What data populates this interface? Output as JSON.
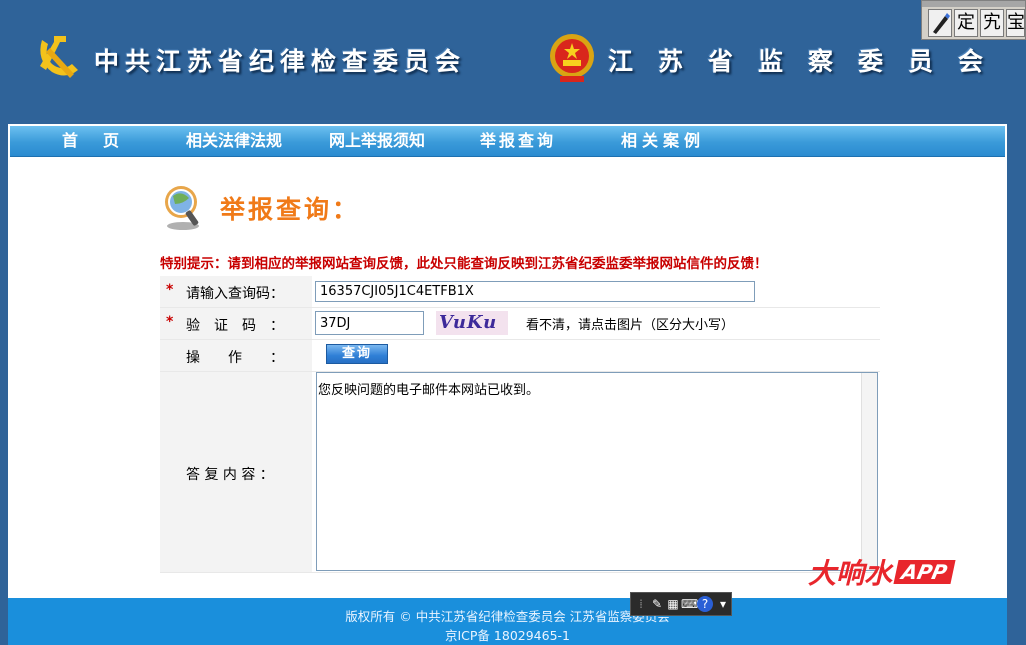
{
  "header": {
    "title_left": "中共江苏省纪律检查委员会",
    "title_right": "江苏省监察委员会"
  },
  "ime_toolbar": {
    "btn1": "定",
    "btn2": "宄",
    "btn3": "宝"
  },
  "nav": {
    "home": "首页",
    "laws": "相关法律法规",
    "notice": "网上举报须知",
    "query": "举报查询",
    "cases": "相关案例"
  },
  "page": {
    "title": "举报查询：",
    "special_notice": "特别提示：请到相应的举报网站查询反馈，此处只能查询反映到江苏省纪委监委举报网站信件的反馈！"
  },
  "form": {
    "required_mark": "*",
    "code_label": "请输入查询码：",
    "code_value": "16357CJI05J1C4ETFB1X",
    "verify_label": "验　证　码　：",
    "verify_value": "37DJ",
    "captcha_text": "VuKu",
    "captcha_hint": "看不清，请点击图片（区分大小写）",
    "op_label": "操　　作　　：",
    "query_button": "查询",
    "reply_label": "答 复 内 容 ：",
    "reply_text": "您反映问题的电子邮件本网站已收到。"
  },
  "footer": {
    "copyright": "版权所有 © 中共江苏省纪律检查委员会 江苏省监察委员会",
    "icp": "京ICP备 18029465-1"
  },
  "watermark": {
    "cn": "大响水",
    "app": "APP"
  },
  "colors": {
    "header_bg": "#2f6399",
    "nav_bg": "#3a9ad9",
    "title_orange": "#f07a18",
    "notice_red": "#c80000",
    "footer_bg": "#1a8fdc"
  }
}
